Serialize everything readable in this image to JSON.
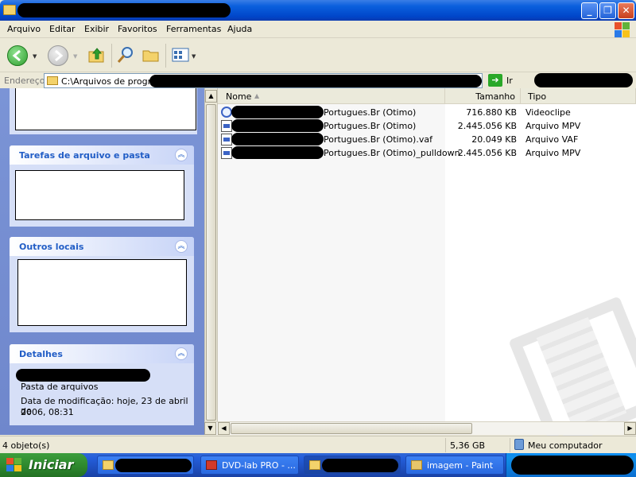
{
  "window": {
    "title": "",
    "controls": {
      "minimize": "_",
      "maximize": "❐",
      "close": "✕"
    }
  },
  "menubar": {
    "items": [
      "Arquivo",
      "Editar",
      "Exibir",
      "Favoritos",
      "Ferramentas",
      "Ajuda"
    ]
  },
  "toolbar": {
    "buttons": [
      "back-icon",
      "forward-icon",
      "up-folder-icon",
      "search-icon",
      "folders-icon",
      "views-icon"
    ]
  },
  "address": {
    "label": "Endereço",
    "path": "C:\\Arquivos de program",
    "go_label": "Ir"
  },
  "taskpane": {
    "file_tasks_title": "Tarefas de arquivo e pasta",
    "other_places_title": "Outros locais",
    "details_title": "Detalhes",
    "details_type": "Pasta de arquivos",
    "details_modified": "Data de modificação: hoje, 23 de abril de",
    "details_modified_2": "2006, 08:31"
  },
  "filelist": {
    "columns": {
      "name": "Nome",
      "size": "Tamanho",
      "type": "Tipo"
    },
    "rows": [
      {
        "name": "Portugues.Br (Otimo)",
        "size": "716.880 KB",
        "type": "Videoclipe"
      },
      {
        "name": "Portugues.Br (Otimo)",
        "size": "2.445.056 KB",
        "type": "Arquivo MPV"
      },
      {
        "name": "Portugues.Br (Otimo).vaf",
        "size": "20.049 KB",
        "type": "Arquivo VAF"
      },
      {
        "name": "Portugues.Br (Otimo)_pulldown",
        "size": "2.445.056 KB",
        "type": "Arquivo MPV"
      }
    ]
  },
  "statusbar": {
    "count": "4 objeto(s)",
    "size": "5,36 GB",
    "location": "Meu computador"
  },
  "taskbar": {
    "start_label": "Iniciar",
    "tasks": [
      "",
      "DVD-lab PRO - ...",
      "",
      "imagem - Paint"
    ]
  }
}
